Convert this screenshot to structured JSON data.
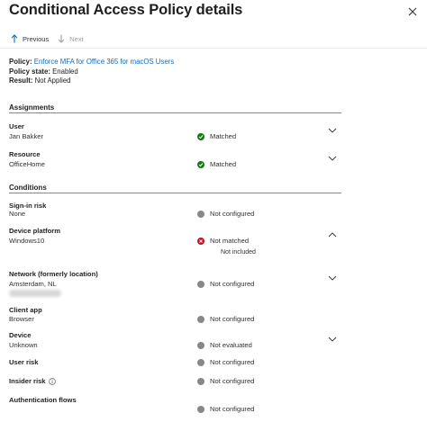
{
  "header": {
    "title": "Conditional Access Policy details"
  },
  "toolbar": {
    "previous_label": "Previous",
    "next_label": "Next"
  },
  "summary": {
    "policy_label": "Policy:",
    "policy_value": "Enforce MFA for Office 365 for macOS Users",
    "state_label": "Policy state:",
    "state_value": "Enabled",
    "result_label": "Result:",
    "result_value": "Not Applied"
  },
  "assignments": {
    "title": "Assignments",
    "user": {
      "label": "User",
      "value": "Jan Bakker",
      "status": "Matched"
    },
    "resource": {
      "label": "Resource",
      "value": "OfficeHome",
      "status": "Matched"
    }
  },
  "conditions": {
    "title": "Conditions",
    "sign_in_risk": {
      "label": "Sign-in risk",
      "value": "None",
      "status": "Not configured"
    },
    "device_platform": {
      "label": "Device platform",
      "value": "Windows10",
      "status": "Not matched",
      "note": "Not included"
    },
    "network": {
      "label": "Network (formerly location)",
      "value": "Amsterdam, NL",
      "status": "Not configured"
    },
    "client_app": {
      "label": "Client app",
      "value": "Browser",
      "status": "Not configured"
    },
    "device": {
      "label": "Device",
      "value": "Unknown",
      "status": "Not evaluated"
    },
    "user_risk": {
      "label": "User risk",
      "status": "Not configured"
    },
    "insider_risk": {
      "label": "Insider risk",
      "status": "Not configured"
    },
    "auth_flows": {
      "label": "Authentication flows",
      "status": "Not configured"
    }
  },
  "colors": {
    "link": "#0f6cbd",
    "matched": "#107c10",
    "not_matched": "#c50f1f",
    "neutral": "#8a8886"
  }
}
